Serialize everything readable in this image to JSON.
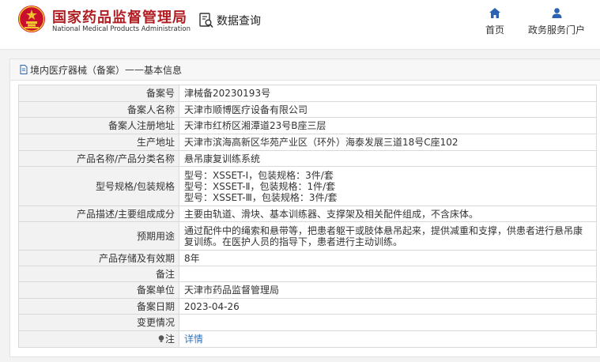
{
  "header": {
    "brand_cn": "国家药品监督管理局",
    "brand_en": "National Medical Products Administration",
    "query_label": "数据查询",
    "nav": {
      "home": "首页",
      "gov_portal": "政务服务门户"
    },
    "colors": {
      "brand_red": "#b01e23",
      "nav_blue": "#2b62b2"
    }
  },
  "card": {
    "title_prefix": "境内医疗器械（备案）",
    "title_sep": "——",
    "title_suffix": "基本信息"
  },
  "rows": {
    "record_no": {
      "label": "备案号",
      "value": "津械备20230193号"
    },
    "registrant_name": {
      "label": "备案人名称",
      "value": "天津市顺博医疗设备有限公司"
    },
    "registrant_address": {
      "label": "备案人注册地址",
      "value": "天津市红桥区湘潭道23号B座三层"
    },
    "production_address": {
      "label": "生产地址",
      "value": "天津市滨海高新区华苑产业区（环外）海泰发展三道18号C座102"
    },
    "product_name": {
      "label": "产品名称/产品分类名称",
      "value": "悬吊康复训练系统"
    },
    "model_spec": {
      "label": "型号规格/包装规格",
      "lines": [
        "型号：XSSET-Ⅰ，包装规格：3件/套",
        "型号：XSSET-Ⅱ，包装规格：1件/套",
        "型号：XSSET-Ⅲ，包装规格：3件/套"
      ]
    },
    "description": {
      "label": "产品描述/主要组成成分",
      "value": "主要由轨道、滑块、基本训练器、支撑架及相关配件组成，不含床体。"
    },
    "intended_use": {
      "label": "预期用途",
      "value": "通过配件中的绳索和悬带等，把患者躯干或肢体悬吊起来，提供减重和支撑，供患者进行悬吊康复训练。在医护人员的指导下，患者进行主动训练。"
    },
    "storage_validity": {
      "label": "产品存储及有效期",
      "value": "8年"
    },
    "remarks": {
      "label": "备注",
      "value": ""
    },
    "record_unit": {
      "label": "备案单位",
      "value": "天津市药品监督管理局"
    },
    "record_date": {
      "label": "备案日期",
      "value": "2023-04-26"
    },
    "changes": {
      "label": "变更情况",
      "value": ""
    },
    "note": {
      "label": "注",
      "link": "详情"
    }
  }
}
